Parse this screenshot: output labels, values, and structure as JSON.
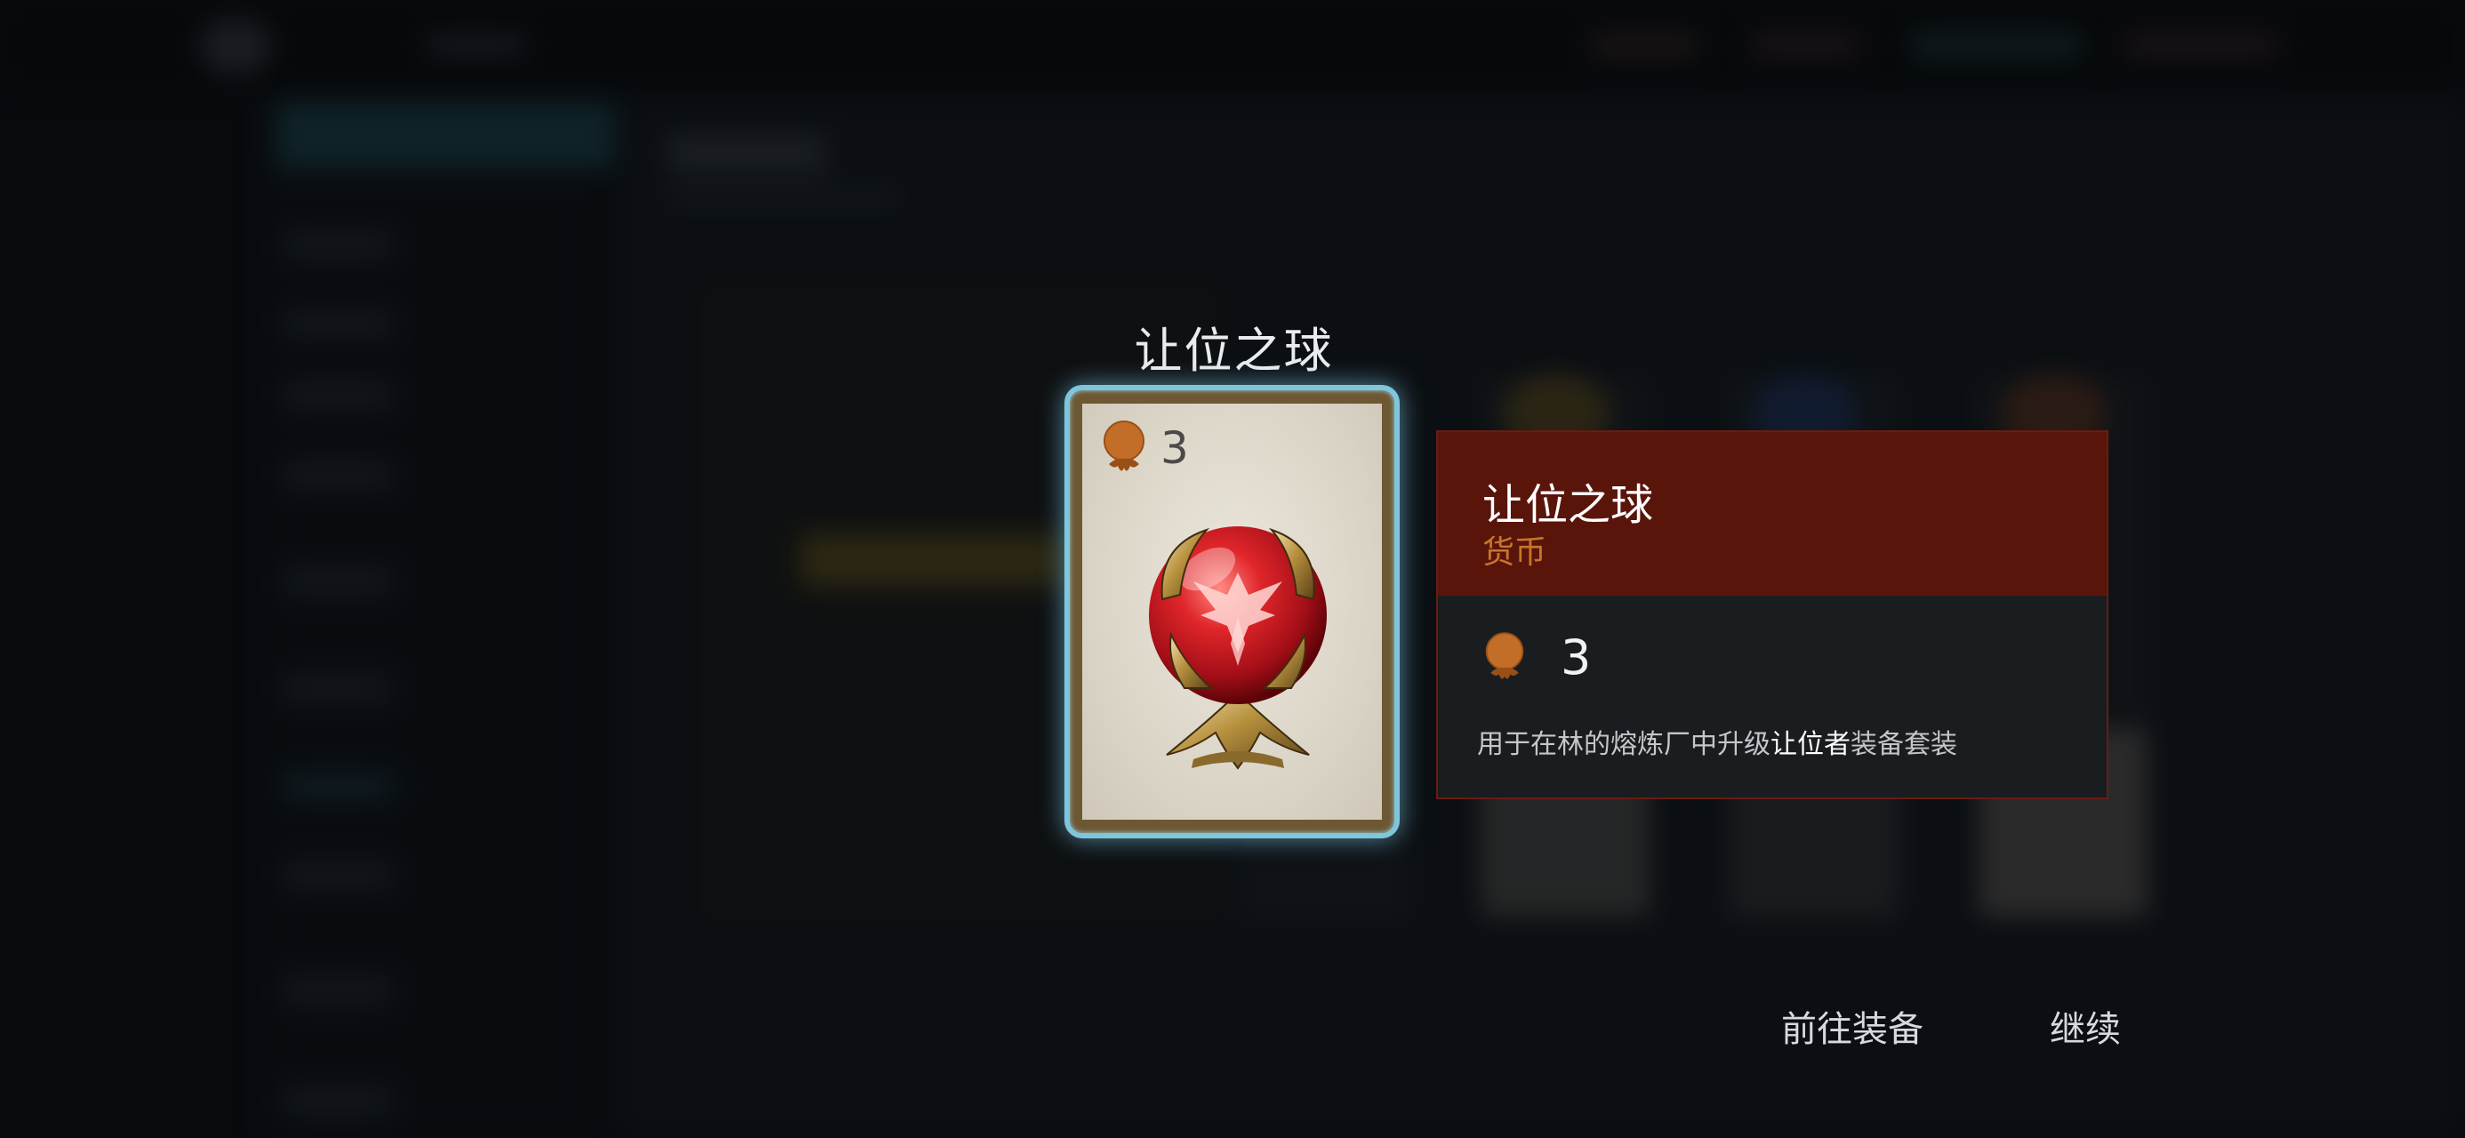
{
  "item": {
    "title": "让位之球",
    "count": "3",
    "card_icon": "medal-icon",
    "art": "red-orb-on-golden-claw-stand"
  },
  "info": {
    "name": "让位之球",
    "type": "货币",
    "amount": "3",
    "description_prefix": "用于在林的熔炼厂中升级",
    "description_highlight": "让位者",
    "description_suffix": "装备套装"
  },
  "actions": {
    "go_equipment": "前往装备",
    "continue": "继续"
  },
  "colors": {
    "card_border_glow": "#7fc6dc",
    "card_frame": "#6d5833",
    "info_header": "#5a150b",
    "info_body": "#1a1d20",
    "type_text": "#c8762c",
    "medal": "#c36e28"
  }
}
